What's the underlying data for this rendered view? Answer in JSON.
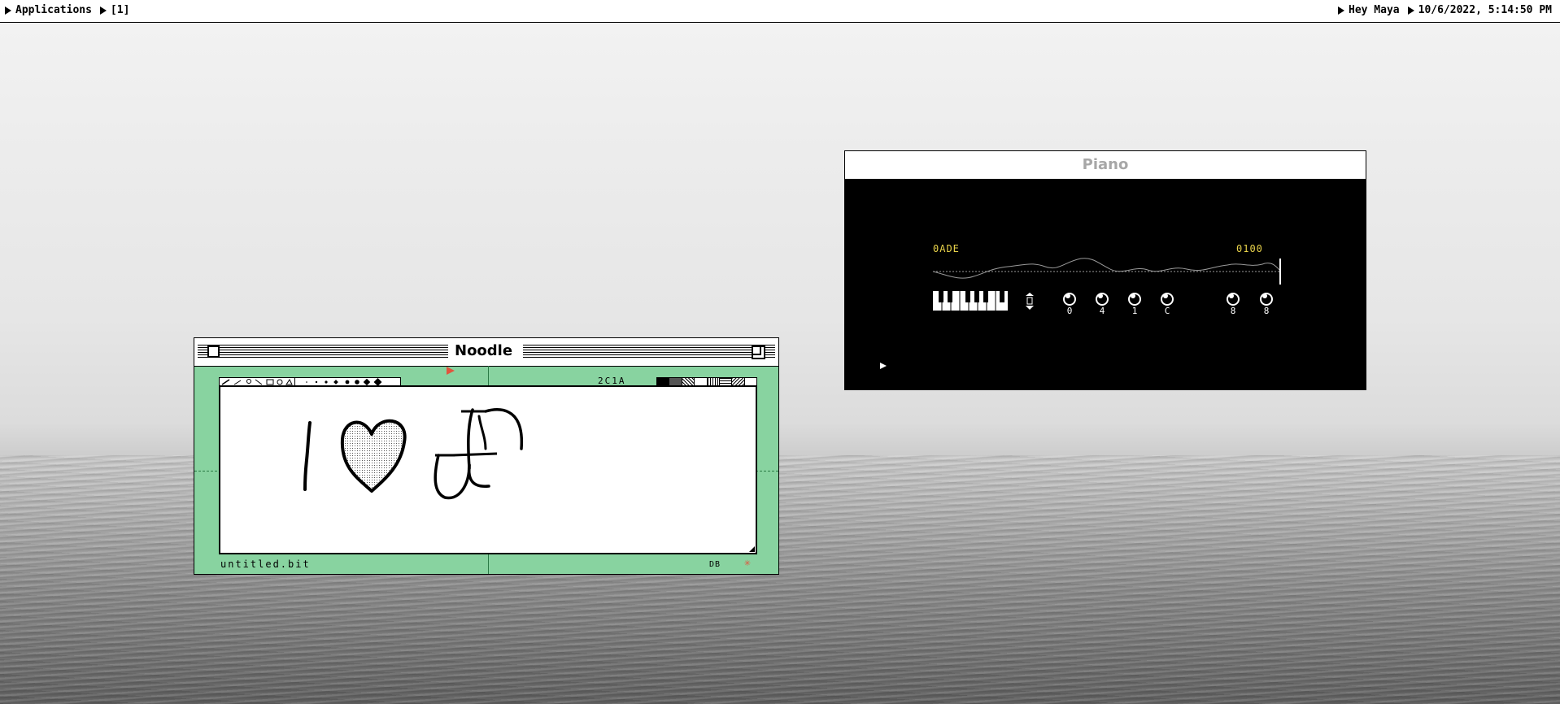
{
  "menubar": {
    "applications": "Applications",
    "workspace": "[1]",
    "user": "Hey Maya",
    "datetime": "10/6/2022, 5:14:50 PM"
  },
  "noodle": {
    "title": "Noodle",
    "coords": "2C1A",
    "filename": "untitled.bit",
    "status_icon": "DB",
    "dirty_icon": "✳"
  },
  "piano": {
    "title": "Piano",
    "left_readout": "0ADE",
    "right_readout": "0100",
    "knob_values": [
      "0",
      "4",
      "1",
      "C",
      "8",
      "8"
    ]
  },
  "colors": {
    "noodle_bg": "#88d3a0",
    "readout": "#e8d24a",
    "accent_red": "#e2543d"
  }
}
